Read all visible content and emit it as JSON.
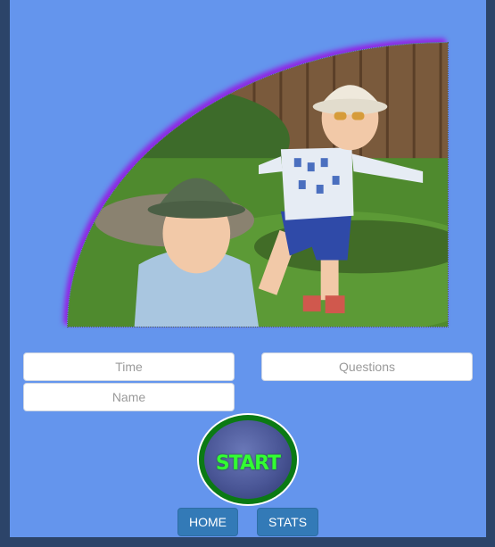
{
  "fields": {
    "time_placeholder": "Time",
    "questions_placeholder": "Questions",
    "name_placeholder": "Name"
  },
  "start_button": {
    "label": "START"
  },
  "nav": {
    "home_label": "HOME",
    "stats_label": "STATS"
  },
  "colors": {
    "panel": "#6495ed",
    "page_background": "#2c4469",
    "nav_button": "#337ab7",
    "photo_glow": "#8a2be2",
    "start_text": "#32ff32"
  }
}
